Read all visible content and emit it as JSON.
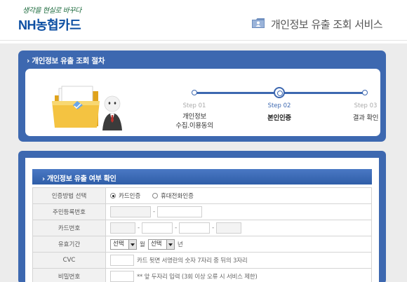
{
  "header": {
    "slogan": "생각을 현실로 바꾸다",
    "logo": "NH농협카드",
    "service_title": "개인정보 유출 조회 서비스"
  },
  "procedure": {
    "title": "›  개인정보 유출 조회 절차",
    "steps": [
      {
        "num": "Step 01",
        "label_line1": "개인정보",
        "label_line2": "수집.이용동의",
        "active": false
      },
      {
        "num": "Step 02",
        "label_line1": "본인인증",
        "label_line2": "",
        "active": true
      },
      {
        "num": "Step 03",
        "label_line1": "결과 확인",
        "label_line2": "",
        "active": false
      }
    ]
  },
  "check": {
    "title": "›  개인정보 유출 여부 확인",
    "rows": {
      "auth_method": {
        "label": "인증방법 선택",
        "options": [
          "카드인증",
          "휴대전화인증"
        ],
        "selected": "카드인증"
      },
      "resident_no": {
        "label": "주민등록번호",
        "separator": "-"
      },
      "card_no": {
        "label": "카드번호",
        "separator": "-"
      },
      "expiry": {
        "label": "유효기간",
        "month_select": "선택",
        "month_unit": "월",
        "year_select": "선택",
        "year_unit": "년"
      },
      "cvc": {
        "label": "CVC",
        "hint": "카드 뒷면 서명란의 숫자 7자리 중 뒤의 3자리"
      },
      "password": {
        "label": "비밀번호",
        "hint": "** 앞 두자리 입력 (3회 이상 오류 시 서비스 제한)"
      }
    }
  },
  "colors": {
    "brand_blue": "#3d68b0",
    "logo_blue": "#0b4ea2"
  }
}
